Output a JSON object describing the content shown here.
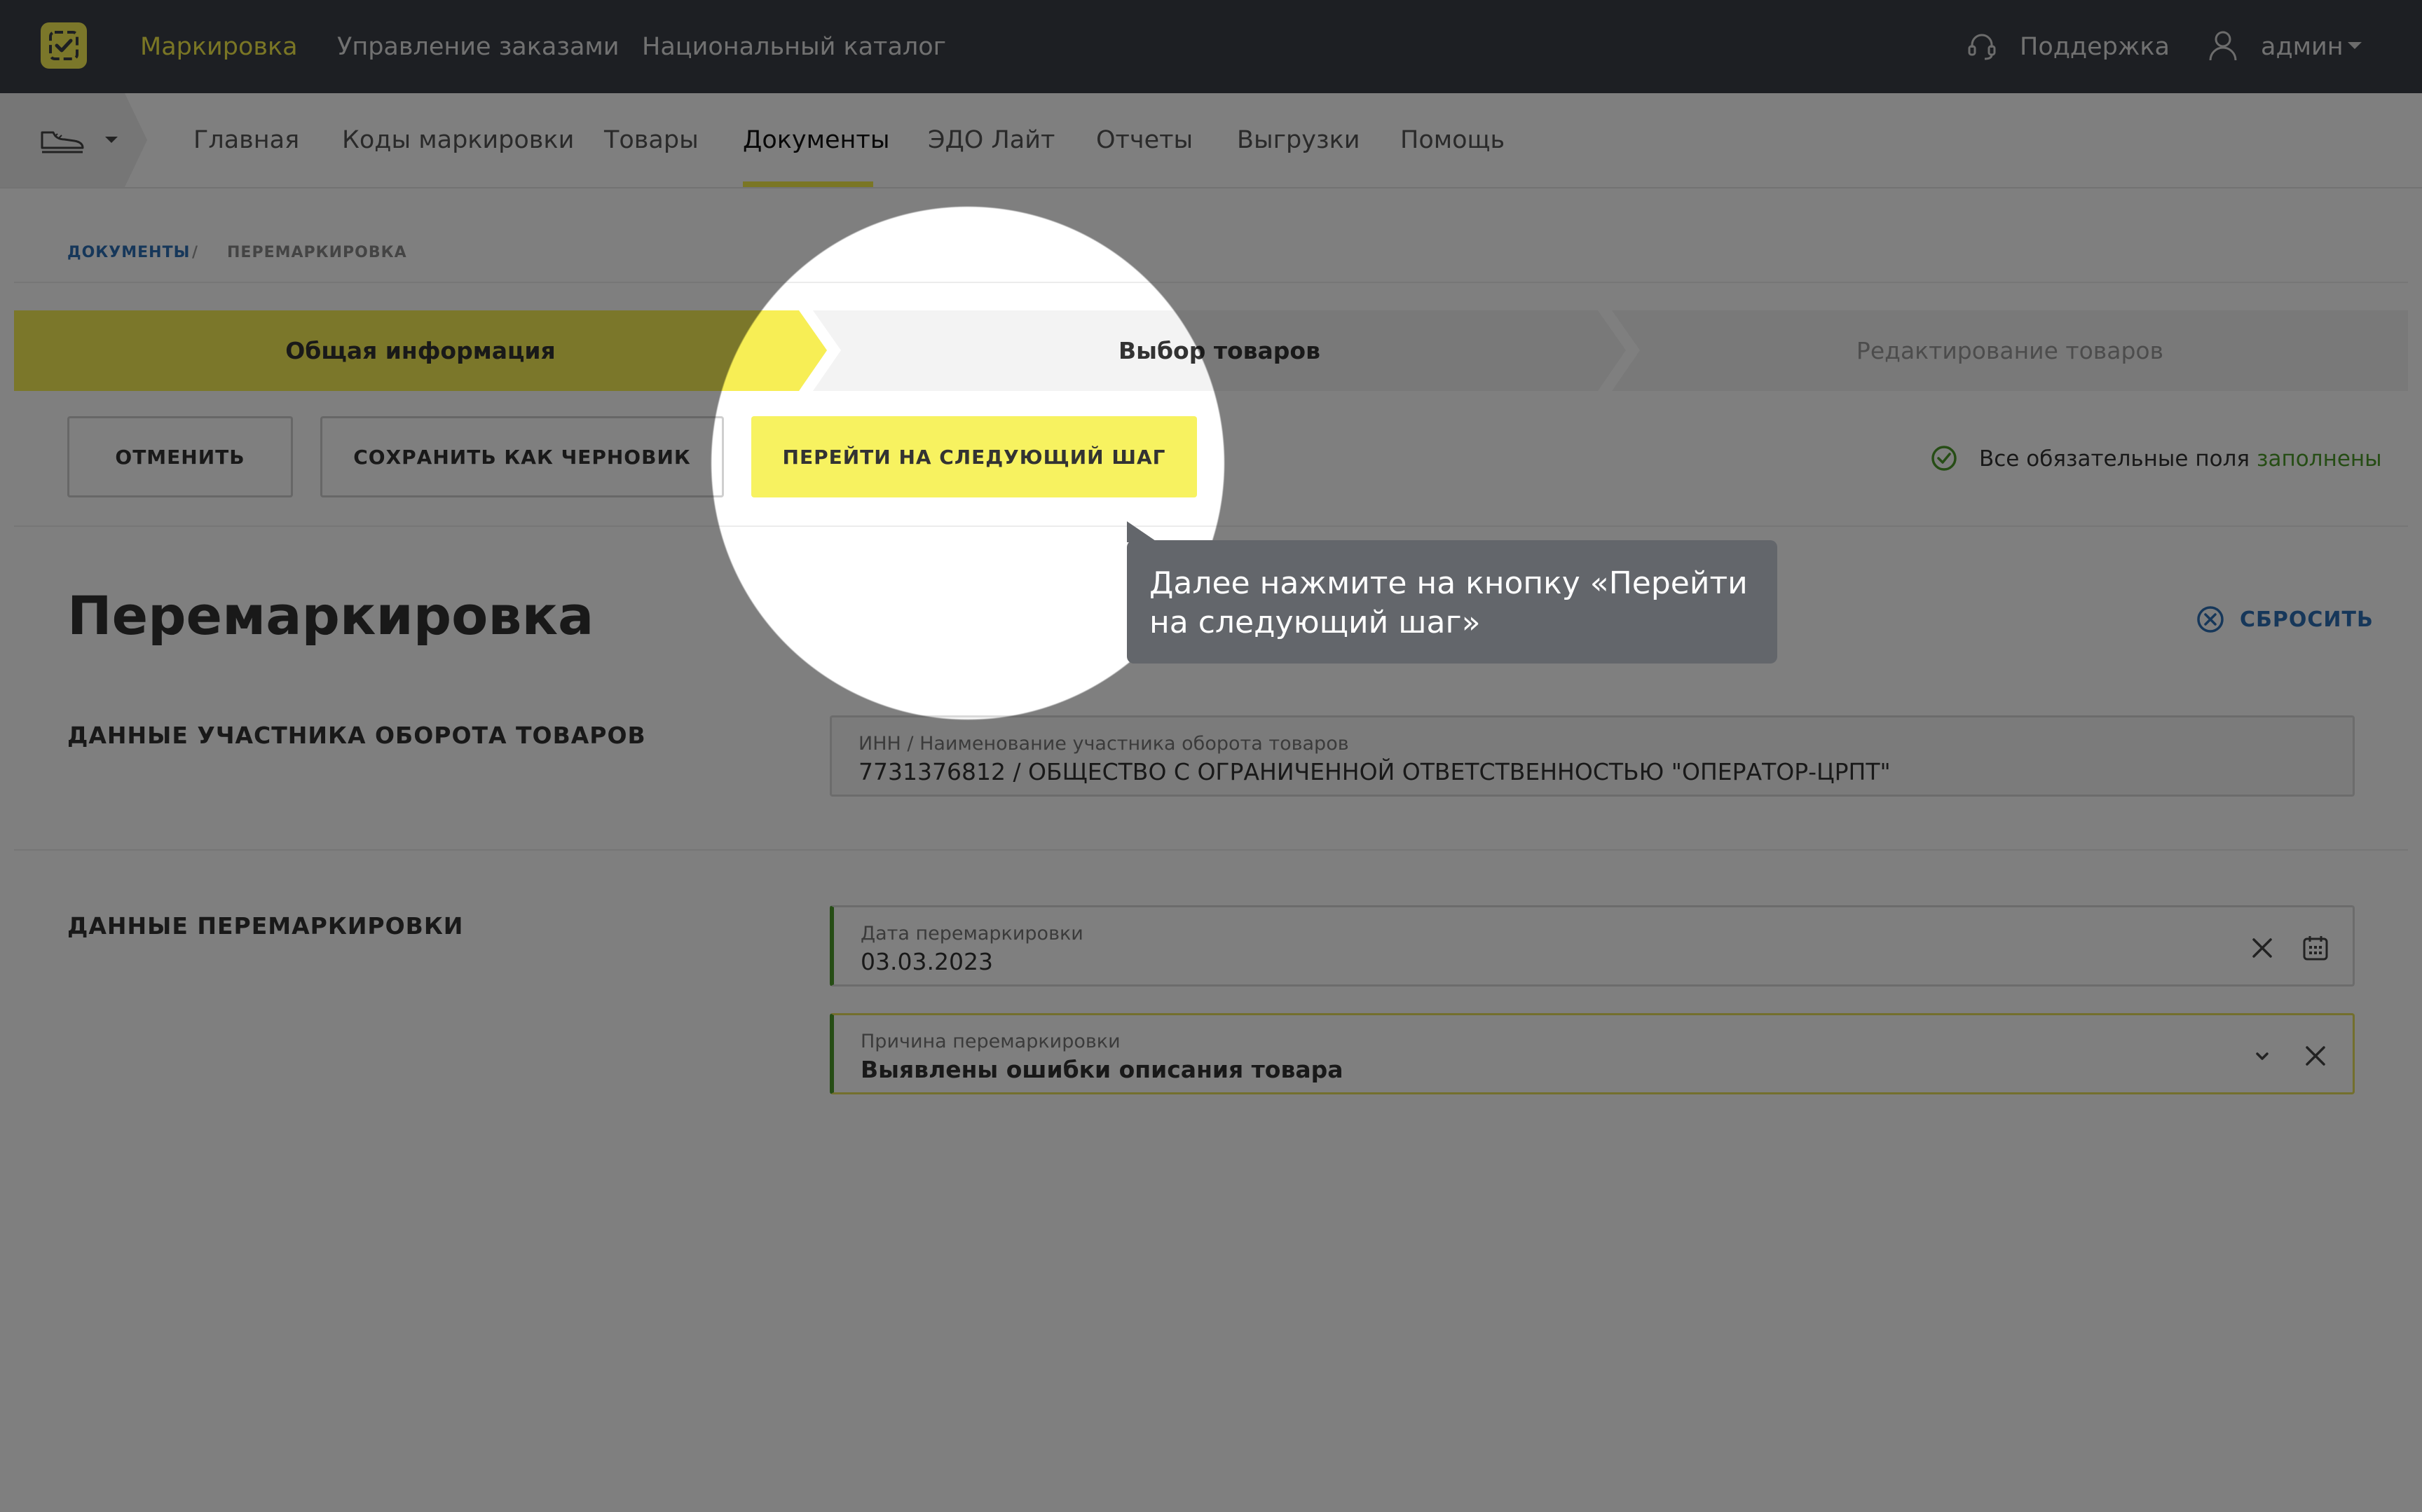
{
  "topbar": {
    "nav": [
      {
        "label": "Маркировка",
        "active": true
      },
      {
        "label": "Управление заказами",
        "active": false
      },
      {
        "label": "Национальный каталог",
        "active": false
      }
    ],
    "support_label": "Поддержка",
    "user_label": "админ",
    "accent_color": "#f5ec4a"
  },
  "subnav": {
    "items": [
      {
        "label": "Главная"
      },
      {
        "label": "Коды маркировки"
      },
      {
        "label": "Товары"
      },
      {
        "label": "Документы",
        "active": true
      },
      {
        "label": "ЭДО Лайт"
      },
      {
        "label": "Отчеты"
      },
      {
        "label": "Выгрузки"
      },
      {
        "label": "Помощь"
      }
    ]
  },
  "breadcrumb": {
    "root": "ДОКУМЕНТЫ",
    "separator": "/",
    "current": "ПЕРЕМАРКИРОВКА"
  },
  "stepper": {
    "steps": [
      {
        "label": "Общая информация",
        "state": "active"
      },
      {
        "label": "Выбор товаров",
        "state": "next"
      },
      {
        "label": "Редактирование товаров",
        "state": "disabled"
      }
    ]
  },
  "actions": {
    "cancel_label": "ОТМЕНИТЬ",
    "save_draft_label": "СОХРАНИТЬ КАК ЧЕРНОВИК",
    "next_step_label": "ПЕРЕЙТИ НА СЛЕДУЮЩИЙ ШАГ",
    "status_text": "Все обязательные поля",
    "status_highlight": "заполнены"
  },
  "form": {
    "title": "Перемаркировка",
    "reset_label": "СБРОСИТЬ",
    "participant_section": "ДАННЫЕ УЧАСТНИКА ОБОРОТА ТОВАРОВ",
    "participant_field": {
      "label": "ИНН / Наименование участника оборота товаров",
      "value": "7731376812 / ОБЩЕСТВО С ОГРАНИЧЕННОЙ ОТВЕТСТВЕННОСТЬЮ \"ОПЕРАТОР-ЦРПТ\""
    },
    "remark_section": "ДАННЫЕ ПЕРЕМАРКИРОВКИ",
    "date_field": {
      "label": "Дата перемаркировки",
      "value": "03.03.2023"
    },
    "reason_field": {
      "label": "Причина перемаркировки",
      "value": "Выявлены ошибки описания товара"
    }
  },
  "tooltip": {
    "text": "Далее нажмите на кнопку «Перейти\nна следующий шаг»"
  }
}
